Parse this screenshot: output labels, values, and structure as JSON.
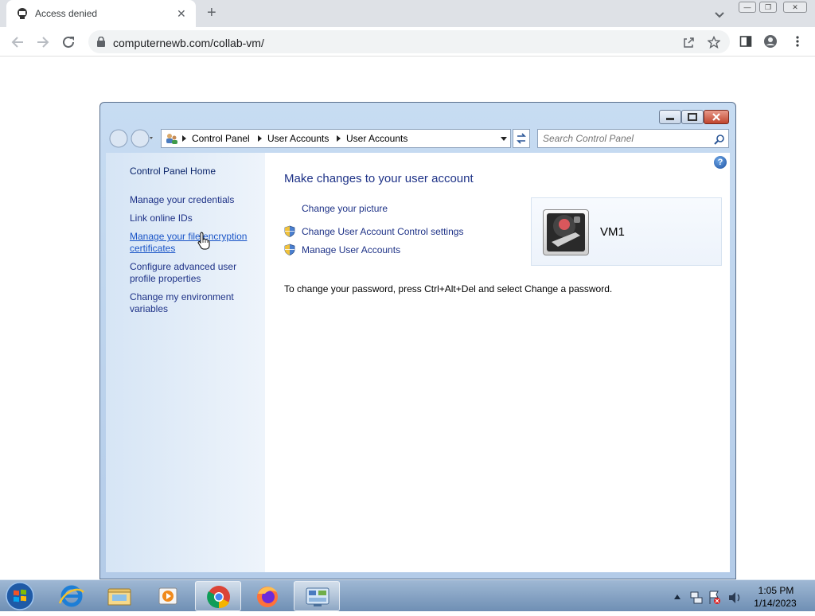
{
  "browser": {
    "tab_title": "Access denied",
    "url": "computernewb.com/collab-vm/"
  },
  "window": {
    "breadcrumbs": [
      "Control Panel",
      "User Accounts",
      "User Accounts"
    ],
    "search_placeholder": "Search Control Panel"
  },
  "sidebar": {
    "home": "Control Panel Home",
    "items": [
      "Manage your credentials",
      "Link online IDs",
      "Manage your file encryption certificates",
      "Configure advanced user profile properties",
      "Change my environment variables"
    ]
  },
  "main": {
    "heading": "Make changes to your user account",
    "tasks": [
      "Change your picture",
      "Change User Account Control settings",
      "Manage User Accounts"
    ],
    "username": "VM1",
    "password_note": "To change your password, press Ctrl+Alt+Del and select Change a password."
  },
  "taskbar": {
    "apps": [
      "internet-explorer-icon",
      "windows-explorer-icon",
      "media-player-icon",
      "chrome-icon",
      "firefox-icon",
      "control-panel-icon"
    ],
    "time": "1:05 PM",
    "date": "1/14/2023"
  },
  "colors": {
    "link": "#1e3287",
    "taskbar": "#6f8fb4",
    "sidebar": "#d6e5f5"
  }
}
